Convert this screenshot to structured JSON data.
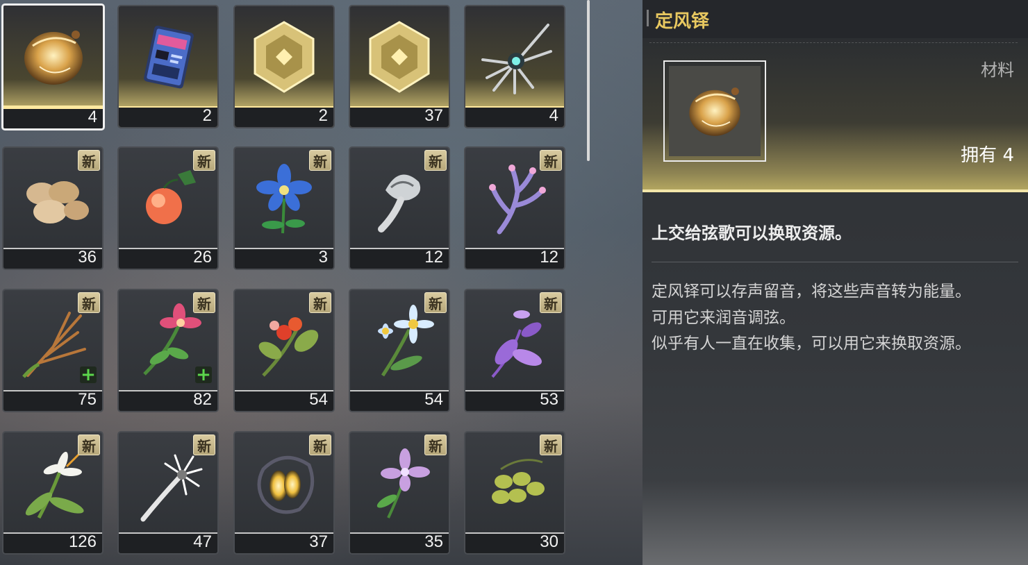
{
  "detail": {
    "title": "定风铎",
    "category": "材料",
    "owned_label": "拥有",
    "owned_count": "4",
    "summary": "上交给弦歌可以换取资源。",
    "lines": [
      "定风铎可以存声留音，将这些声音转为能量。",
      "可用它来润音调弦。",
      "似乎有人一直在收集，可以用它来换取资源。"
    ]
  },
  "new_badge": "新",
  "plus_badge": "+",
  "items": [
    {
      "icon": "wind-bell-icon",
      "count": "4",
      "rarity": "gold",
      "new": false,
      "plus": false,
      "selected": true
    },
    {
      "icon": "data-card-icon",
      "count": "2",
      "rarity": "gold",
      "new": false,
      "plus": false
    },
    {
      "icon": "gold-crystal-icon",
      "count": "2",
      "rarity": "gold",
      "new": false,
      "plus": false
    },
    {
      "icon": "gold-crystal-icon",
      "count": "37",
      "rarity": "gold",
      "new": false,
      "plus": false
    },
    {
      "icon": "feather-orb-icon",
      "count": "4",
      "rarity": "gold",
      "new": false,
      "plus": false
    },
    {
      "icon": "nuts-icon",
      "count": "36",
      "rarity": "normal",
      "new": true,
      "plus": false
    },
    {
      "icon": "orange-fruit-icon",
      "count": "26",
      "rarity": "normal",
      "new": true,
      "plus": false
    },
    {
      "icon": "blue-flower-icon",
      "count": "3",
      "rarity": "normal",
      "new": true,
      "plus": false
    },
    {
      "icon": "silver-mushroom-icon",
      "count": "12",
      "rarity": "normal",
      "new": true,
      "plus": false
    },
    {
      "icon": "coral-icon",
      "count": "12",
      "rarity": "normal",
      "new": true,
      "plus": false
    },
    {
      "icon": "wheat-grass-icon",
      "count": "75",
      "rarity": "normal",
      "new": true,
      "plus": true
    },
    {
      "icon": "pink-lily-icon",
      "count": "82",
      "rarity": "normal",
      "new": true,
      "plus": true
    },
    {
      "icon": "red-berry-icon",
      "count": "54",
      "rarity": "normal",
      "new": true,
      "plus": false
    },
    {
      "icon": "daisy-icon",
      "count": "54",
      "rarity": "normal",
      "new": true,
      "plus": false
    },
    {
      "icon": "violet-herb-icon",
      "count": "53",
      "rarity": "normal",
      "new": true,
      "plus": false
    },
    {
      "icon": "white-lily-icon",
      "count": "126",
      "rarity": "normal",
      "new": true,
      "plus": false
    },
    {
      "icon": "white-thistle-icon",
      "count": "47",
      "rarity": "normal",
      "new": true,
      "plus": false
    },
    {
      "icon": "glowing-pod-icon",
      "count": "37",
      "rarity": "normal",
      "new": true,
      "plus": false
    },
    {
      "icon": "purple-orchid-icon",
      "count": "35",
      "rarity": "normal",
      "new": true,
      "plus": false
    },
    {
      "icon": "olive-berry-icon",
      "count": "30",
      "rarity": "normal",
      "new": true,
      "plus": false
    }
  ]
}
